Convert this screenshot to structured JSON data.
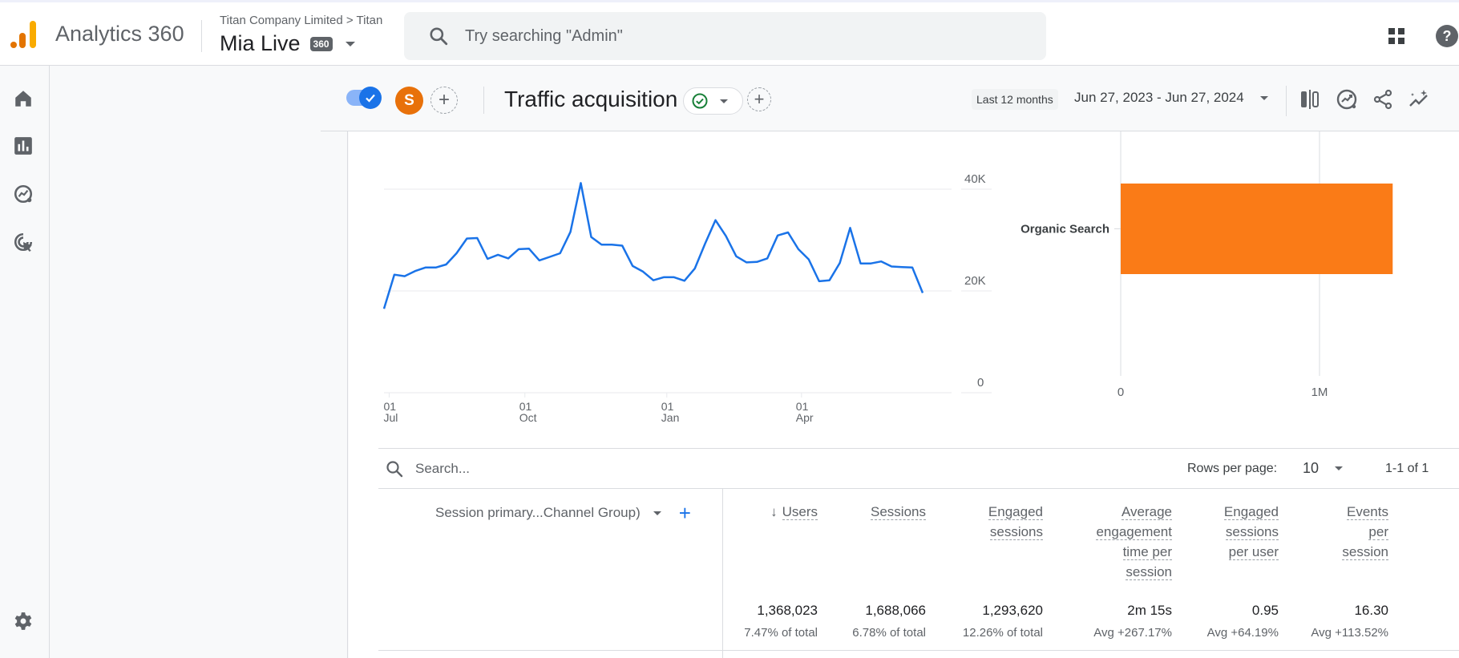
{
  "header": {
    "app_name": "Analytics 360",
    "breadcrumb": "Titan Company Limited > Titan",
    "property_name": "Mia Live",
    "property_badge": "360",
    "search_placeholder": "Try searching \"Admin\"",
    "icons": [
      "analytics-logo",
      "search-icon",
      "apps-grid-icon",
      "help-icon"
    ]
  },
  "sidebar": {
    "items": [
      {
        "name": "home",
        "icon": "home-icon"
      },
      {
        "name": "reports",
        "icon": "bar-chart-icon"
      },
      {
        "name": "explore",
        "icon": "explore-icon"
      },
      {
        "name": "advertising",
        "icon": "target-cursor-icon"
      }
    ],
    "footer_icon": "settings-gear-icon"
  },
  "report_bar": {
    "comparison_toggle": true,
    "avatar_letter": "S",
    "title": "Traffic acquisition",
    "status": "check-circle",
    "date_preset": "Last 12 months",
    "date_range": "Jun 27, 2023 - Jun 27, 2024",
    "toolbar_icons": [
      "compare-icon",
      "insights-icon",
      "share-icon",
      "sparkle-trend-icon"
    ],
    "colors": {
      "accent": "#1a73e8",
      "avatar": "#e8710a",
      "status_ok": "#188038"
    }
  },
  "chart_data": [
    {
      "type": "line",
      "title": "",
      "xlabel": "",
      "ylabel": "",
      "ylim": [
        0,
        46000
      ],
      "y_ticks": [
        "0",
        "20K",
        "40K"
      ],
      "y_tick_values": [
        0,
        20000,
        40000
      ],
      "x_ticks": [
        {
          "day": "01",
          "month": "Jul",
          "index": 0.5
        },
        {
          "day": "01",
          "month": "Oct",
          "index": 13.6
        },
        {
          "day": "01",
          "month": "Jan",
          "index": 27.3
        },
        {
          "day": "01",
          "month": "Apr",
          "index": 40.3
        }
      ],
      "series": [
        {
          "name": "Organic Search",
          "color": "#1a73e8",
          "values": [
            16500,
            23200,
            22900,
            23900,
            24600,
            24600,
            25200,
            27400,
            30300,
            30400,
            26300,
            27100,
            26400,
            28200,
            28300,
            26000,
            26700,
            27400,
            31600,
            41200,
            30600,
            29100,
            29100,
            28900,
            24900,
            23800,
            22100,
            22700,
            22700,
            22000,
            24400,
            29300,
            33900,
            30800,
            26800,
            25600,
            25700,
            26400,
            30900,
            31500,
            28200,
            26200,
            21900,
            22100,
            25500,
            32400,
            25400,
            25400,
            25800,
            24800,
            24700,
            24600,
            19600
          ]
        }
      ]
    },
    {
      "type": "bar",
      "orientation": "horizontal",
      "categories": [
        "Organic Search"
      ],
      "values": [
        1368023
      ],
      "color": "#fa7b17",
      "x_ticks": [
        "0",
        "1M"
      ],
      "x_tick_values": [
        0,
        1000000
      ],
      "xlim": [
        0,
        1500000
      ]
    }
  ],
  "table": {
    "search_placeholder": "Search...",
    "rows_per_page_label": "Rows per page:",
    "rows_per_page": "10",
    "pagination": "1-1 of 1",
    "dimension_header": "Session primary...Channel Group)",
    "columns": [
      {
        "lines": [
          "Users"
        ],
        "sorted": "desc",
        "value": "1,368,023",
        "sub": "7.47% of total"
      },
      {
        "lines": [
          "Sessions"
        ],
        "value": "1,688,066",
        "sub": "6.78% of total"
      },
      {
        "lines": [
          "Engaged",
          "sessions"
        ],
        "value": "1,293,620",
        "sub": "12.26% of total"
      },
      {
        "lines": [
          "Average",
          "engagement",
          "time per",
          "session"
        ],
        "value": "2m 15s",
        "sub": "Avg +267.17%"
      },
      {
        "lines": [
          "Engaged",
          "sessions",
          "per user"
        ],
        "value": "0.95",
        "sub": "Avg +64.19%"
      },
      {
        "lines": [
          "Events",
          "per",
          "session"
        ],
        "value": "16.30",
        "sub": "Avg +113.52%"
      }
    ]
  }
}
